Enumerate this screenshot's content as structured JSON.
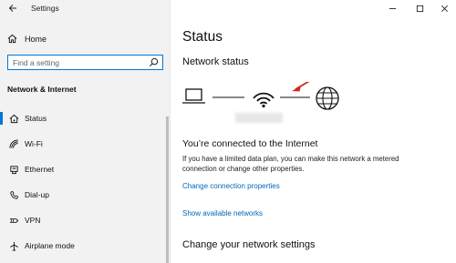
{
  "window": {
    "title": "Settings"
  },
  "sidebar": {
    "home_label": "Home",
    "search_placeholder": "Find a setting",
    "section_title": "Network & Internet",
    "items": [
      {
        "label": "Status",
        "icon": "home-network-icon",
        "active": true
      },
      {
        "label": "Wi-Fi",
        "icon": "wifi-icon"
      },
      {
        "label": "Ethernet",
        "icon": "ethernet-icon"
      },
      {
        "label": "Dial-up",
        "icon": "phone-icon"
      },
      {
        "label": "VPN",
        "icon": "vpn-icon"
      },
      {
        "label": "Airplane mode",
        "icon": "airplane-icon"
      }
    ]
  },
  "main": {
    "title": "Status",
    "network_status_heading": "Network status",
    "connected_text": "You’re connected to the Internet",
    "description": "If you have a limited data plan, you can make this network a metered connection or change other properties.",
    "link_change_properties": "Change connection properties",
    "link_show_networks": "Show available networks",
    "change_settings_heading": "Change your network settings"
  },
  "colors": {
    "accent": "#0078d7",
    "link": "#0067b8",
    "arrow": "#d9241b",
    "sidebar_bg": "#f2f2f2"
  }
}
